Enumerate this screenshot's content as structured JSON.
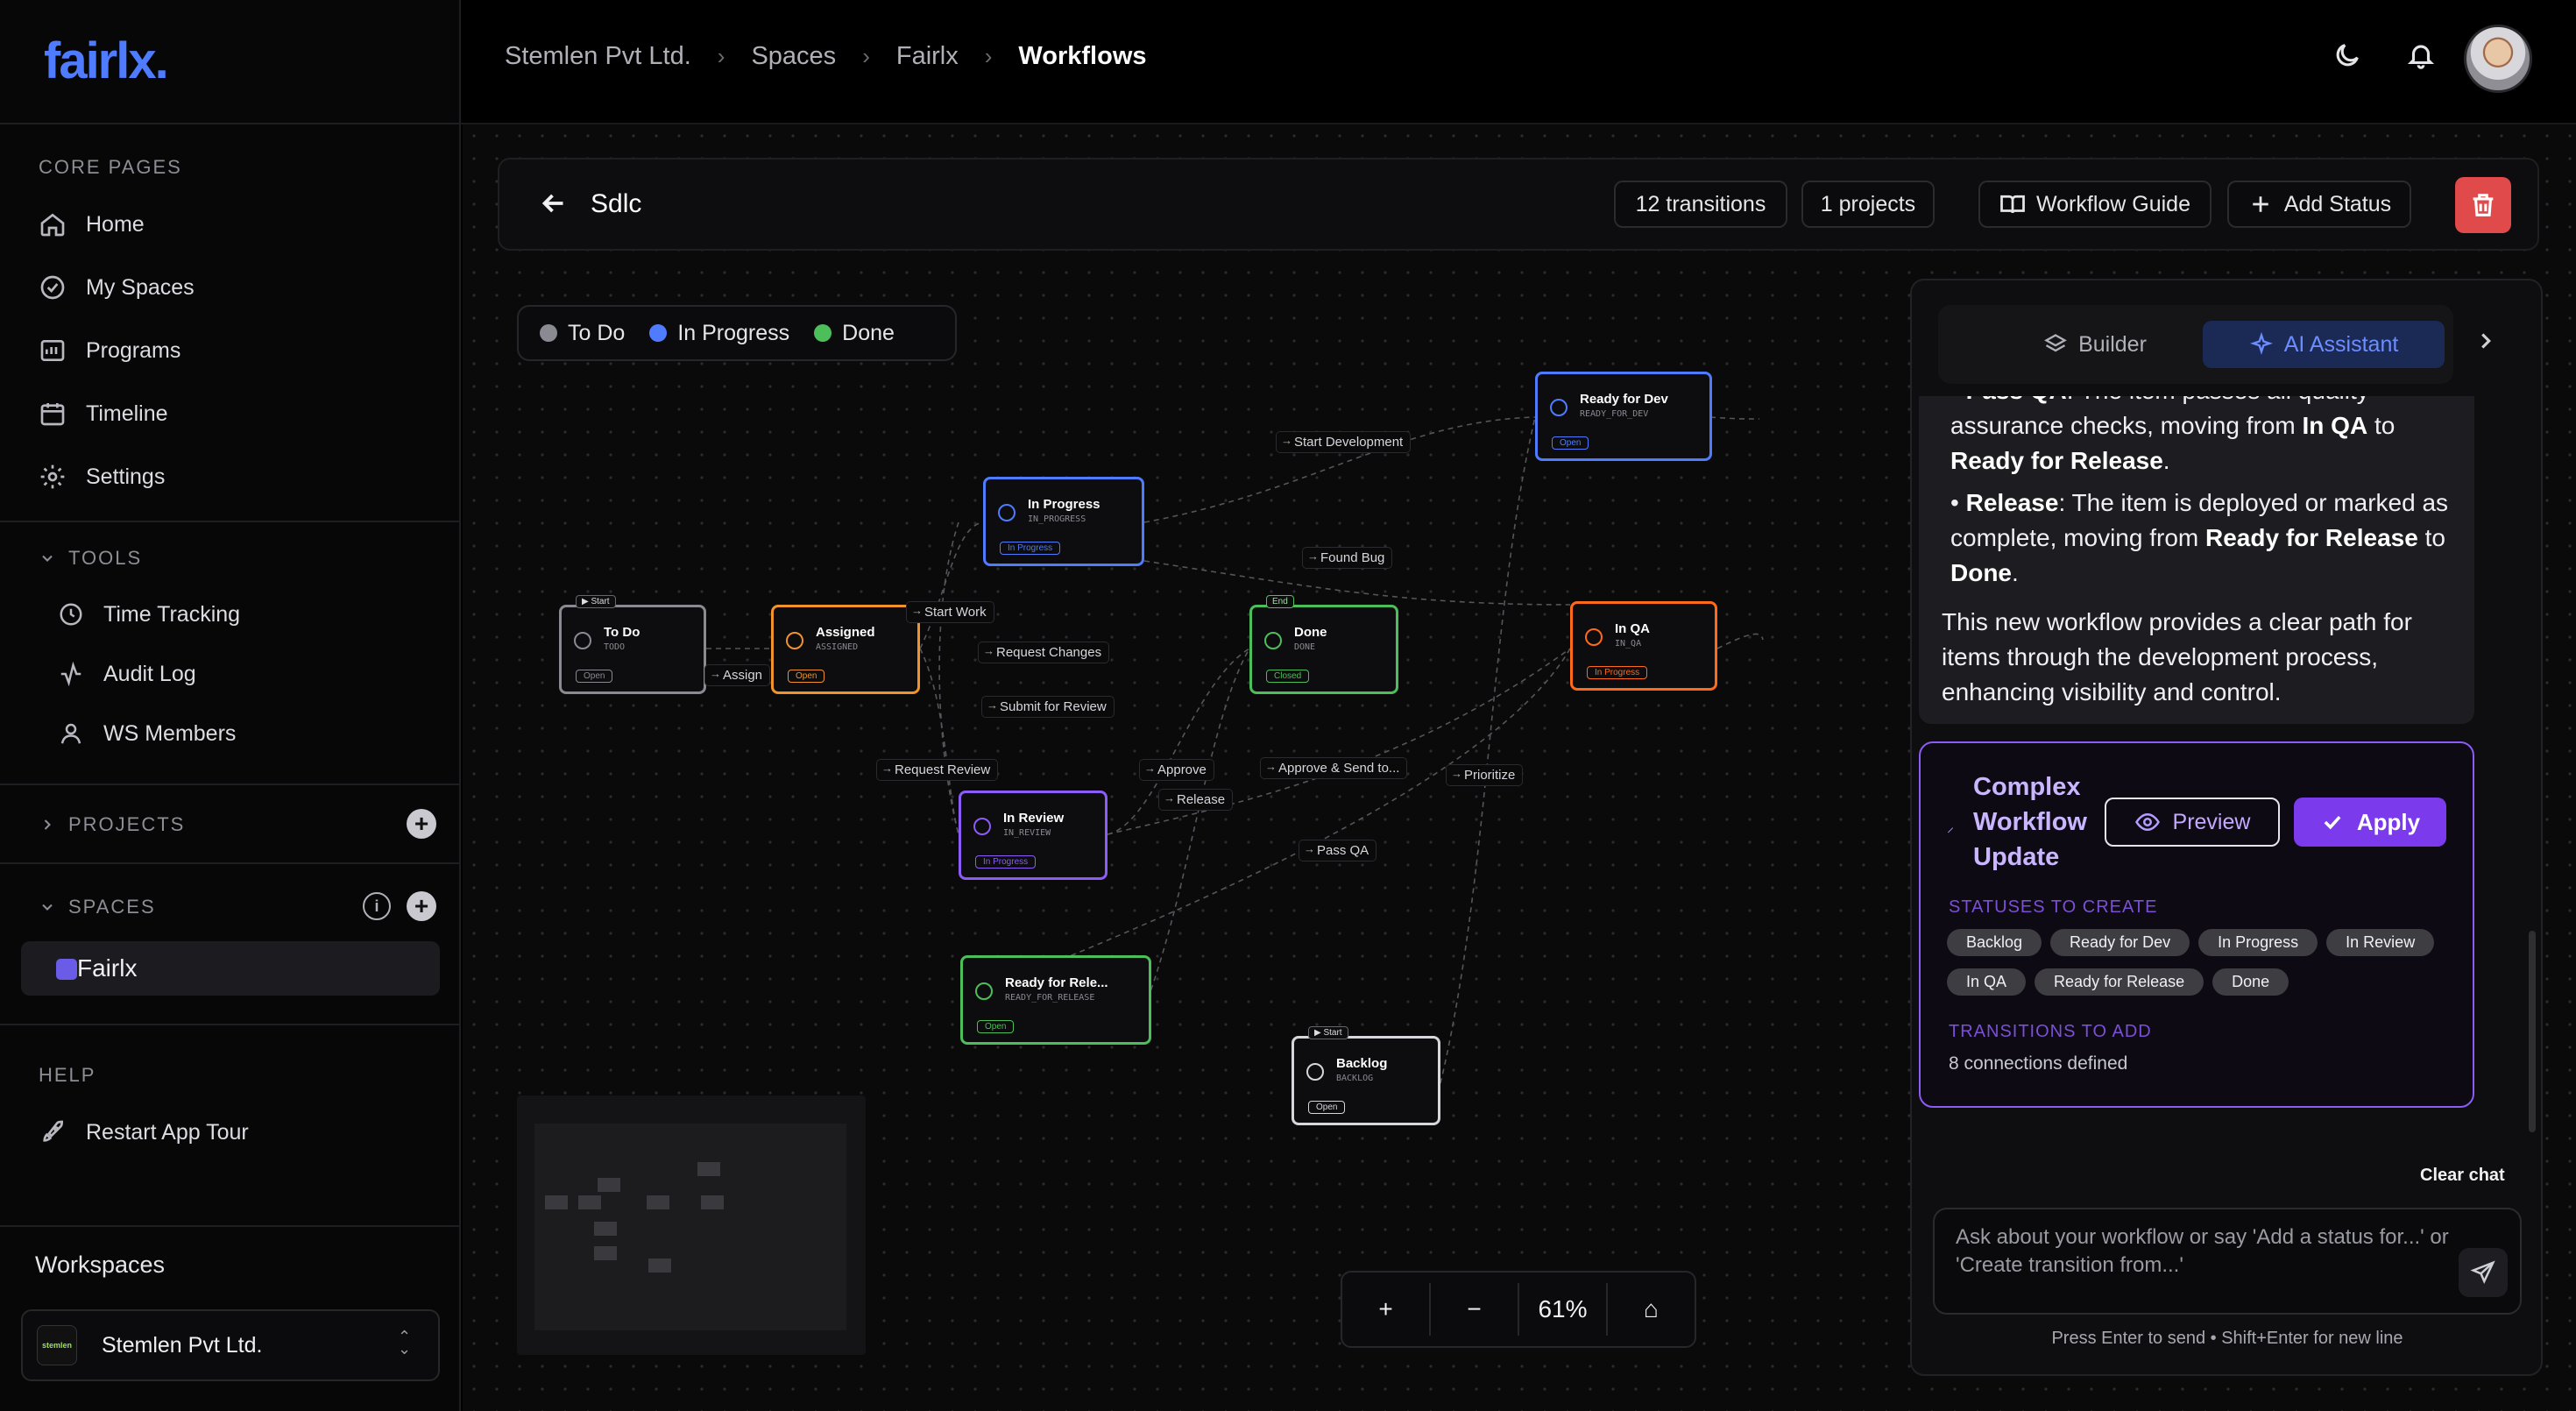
{
  "brand": {
    "logo": "fairlx.",
    "accent": "#4f7cff"
  },
  "sidebar": {
    "core_label": "CORE PAGES",
    "core_items": [
      {
        "label": "Home",
        "icon": "home-icon"
      },
      {
        "label": "My Spaces",
        "icon": "check-circle-icon"
      },
      {
        "label": "Programs",
        "icon": "chart-icon"
      },
      {
        "label": "Timeline",
        "icon": "calendar-icon"
      },
      {
        "label": "Settings",
        "icon": "gear-icon"
      }
    ],
    "tools_label": "TOOLS",
    "tools_items": [
      {
        "label": "Time Tracking",
        "icon": "clock-icon"
      },
      {
        "label": "Audit Log",
        "icon": "activity-icon"
      },
      {
        "label": "WS Members",
        "icon": "user-icon"
      }
    ],
    "projects_label": "PROJECTS",
    "spaces_label": "SPACES",
    "spaces": [
      {
        "label": "Fairlx",
        "color": "#6b5ce7"
      }
    ],
    "help_label": "HELP",
    "help_items": [
      {
        "label": "Restart App Tour",
        "icon": "rocket-icon"
      }
    ],
    "workspaces_label": "Workspaces",
    "workspace": {
      "name": "Stemlen Pvt Ltd.",
      "logo_text": "stemlen"
    }
  },
  "header": {
    "breadcrumbs": [
      "Stemlen Pvt Ltd.",
      "Spaces",
      "Fairlx",
      "Workflows"
    ]
  },
  "toolbar": {
    "title": "Sdlc",
    "transitions": "12 transitions",
    "projects": "1 projects",
    "guide_label": "Workflow Guide",
    "add_status_label": "Add Status",
    "delete_color": "#e04a4a"
  },
  "legend": [
    {
      "label": "To Do",
      "color": "#8a8a92"
    },
    {
      "label": "In Progress",
      "color": "#4f7cff"
    },
    {
      "label": "Done",
      "color": "#4cbf5a"
    }
  ],
  "nodes": [
    {
      "name": "To Do",
      "code": "TODO",
      "tag": "Open",
      "flag": "▶ Start",
      "color": "#8a8a92"
    },
    {
      "name": "Assigned",
      "code": "ASSIGNED",
      "tag": "Open",
      "color": "#f0932b"
    },
    {
      "name": "In Progress",
      "code": "IN_PROGRESS",
      "tag": "In Progress",
      "color": "#4f7cff"
    },
    {
      "name": "Done",
      "code": "DONE",
      "tag": "Closed",
      "flag": "End",
      "color": "#4cbf5a"
    },
    {
      "name": "Ready for Dev",
      "code": "READY_FOR_DEV",
      "tag": "Open",
      "color": "#4f7cff"
    },
    {
      "name": "In QA",
      "code": "IN_QA",
      "tag": "In Progress",
      "color": "#ff6a1a"
    },
    {
      "name": "In Review",
      "code": "IN_REVIEW",
      "tag": "In Progress",
      "color": "#8b5cf6"
    },
    {
      "name": "Ready for Rele...",
      "code": "READY_FOR_RELEASE",
      "tag": "Open",
      "color": "#4cbf5a"
    },
    {
      "name": "Backlog",
      "code": "BACKLOG",
      "tag": "Open",
      "flag": "▶ Start",
      "color": "#d6d6dc"
    }
  ],
  "edge_labels": [
    "Start Development",
    "Found Bug",
    "Start Work",
    "Assign",
    "Request Changes",
    "Submit for Review",
    "Request Review",
    "Approve",
    "Release",
    "Approve & Send to...",
    "Prioritize",
    "Pass QA"
  ],
  "zoom": {
    "plus": "+",
    "minus": "−",
    "level": "61%",
    "home": "⌂"
  },
  "ai_panel": {
    "tab_builder": "Builder",
    "tab_ai": "AI Assistant",
    "message": {
      "b1_bold": "Pass QA",
      "b1_text": ": The item passes all quality assurance checks, moving from ",
      "b1_from": "In QA",
      "b1_mid": " to ",
      "b1_to": "Ready for Release",
      "b1_end": ".",
      "b2_bold": "Release",
      "b2_text": ": The item is deployed or marked as complete, moving from ",
      "b2_from": "Ready for Release",
      "b2_mid": " to ",
      "b2_to": "Done",
      "b2_end": ".",
      "closing": "This new workflow provides a clear path for items through the development process, enhancing visibility and control."
    },
    "card": {
      "title": "Complex Workflow Update",
      "preview_label": "Preview",
      "apply_label": "Apply",
      "statuses_label": "STATUSES TO CREATE",
      "statuses": [
        "Backlog",
        "Ready for Dev",
        "In Progress",
        "In Review",
        "In QA",
        "Ready for Release",
        "Done"
      ],
      "transitions_label": "TRANSITIONS TO ADD",
      "connections": "8 connections defined"
    },
    "clear_label": "Clear chat",
    "input_placeholder": "Ask about your workflow or say 'Add a status for...' or 'Create transition from...'",
    "hint": "Press Enter to send • Shift+Enter for new line"
  }
}
